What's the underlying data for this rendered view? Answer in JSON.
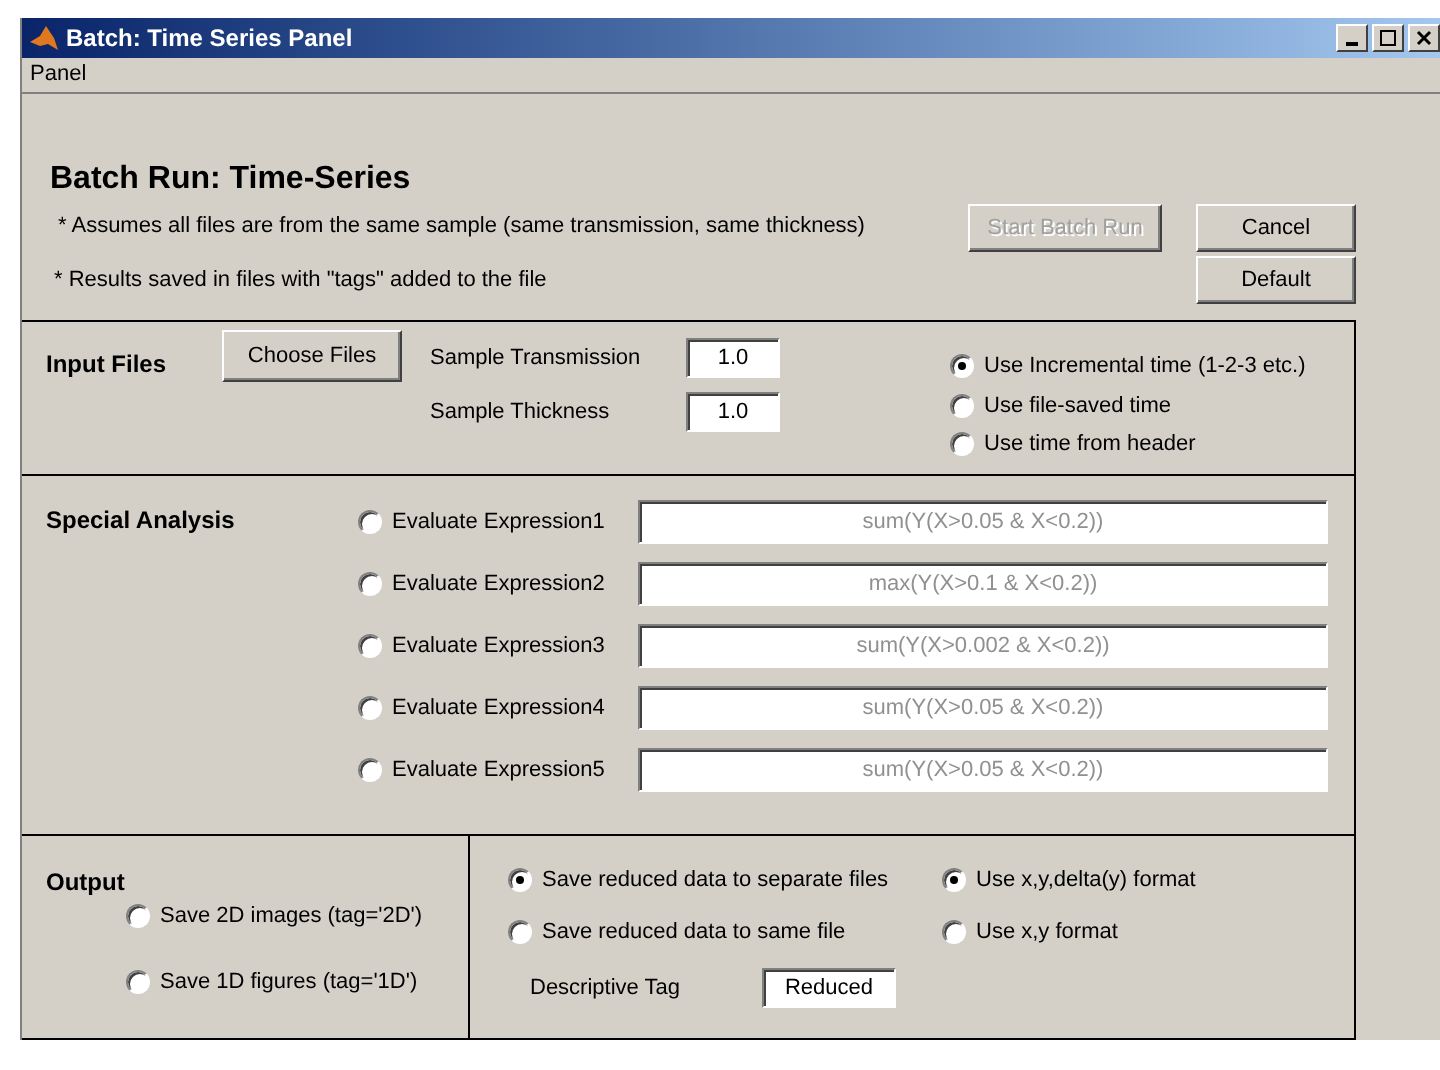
{
  "window": {
    "title": "Batch: Time Series Panel"
  },
  "menu": [
    "Panel"
  ],
  "heading": "Batch Run: Time-Series",
  "notes": [
    "* Assumes all files are from the same sample (same transmission, same thickness)",
    "* Results saved in files with \"tags\" added to the file"
  ],
  "buttons": [
    {
      "label": "Start Batch Run",
      "disabled": true
    },
    {
      "label": "Cancel",
      "disabled": false
    },
    {
      "label": "Default",
      "disabled": false
    }
  ],
  "input_files": {
    "title": "Input Files",
    "choose_button": "Choose Files",
    "fields": [
      {
        "label": "Sample Transmission",
        "value": "1.0"
      },
      {
        "label": "Sample Thickness",
        "value": "1.0"
      }
    ],
    "time_options": [
      {
        "label": "Use Incremental time (1-2-3 etc.)",
        "selected": true
      },
      {
        "label": "Use file-saved time",
        "selected": false
      },
      {
        "label": "Use time from header",
        "selected": false
      }
    ]
  },
  "special_analysis": {
    "title": "Special Analysis",
    "expressions": [
      {
        "label": "Evaluate Expression1",
        "selected": false,
        "disabled": true,
        "value": "sum(Y(X>0.05 & X<0.2))"
      },
      {
        "label": "Evaluate Expression2",
        "selected": false,
        "disabled": true,
        "value": "max(Y(X>0.1 & X<0.2))"
      },
      {
        "label": "Evaluate Expression3",
        "selected": false,
        "disabled": true,
        "value": "sum(Y(X>0.002 & X<0.2))"
      },
      {
        "label": "Evaluate Expression4",
        "selected": false,
        "disabled": true,
        "value": "sum(Y(X>0.05 & X<0.2))"
      },
      {
        "label": "Evaluate Expression5",
        "selected": false,
        "disabled": true,
        "value": "sum(Y(X>0.05 & X<0.2))"
      }
    ]
  },
  "output": {
    "title": "Output",
    "save_options": [
      {
        "label": "Save 2D images (tag='2D')",
        "selected": false
      },
      {
        "label": "Save 1D figures (tag='1D')",
        "selected": false
      }
    ],
    "file_options": [
      {
        "label": "Save reduced data to separate files",
        "selected": true
      },
      {
        "label": "Save reduced data to same file",
        "selected": false
      }
    ],
    "format_options": [
      {
        "label": "Use x,y,delta(y) format",
        "selected": true
      },
      {
        "label": "Use x,y format",
        "selected": false
      }
    ],
    "tag": {
      "label": "Descriptive Tag",
      "value": "Reduced"
    }
  }
}
